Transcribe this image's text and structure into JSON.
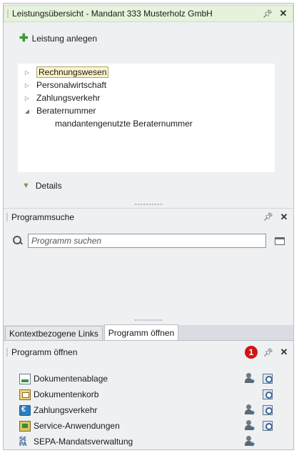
{
  "panel1": {
    "title": "Leistungsübersicht - Mandant 333 Musterholz GmbH",
    "add_label": "Leistung anlegen",
    "tree": [
      {
        "label": "Rechnungswesen",
        "expander": "▷"
      },
      {
        "label": "Personalwirtschaft",
        "expander": "▷"
      },
      {
        "label": "Zahlungsverkehr",
        "expander": "▷"
      },
      {
        "label": "Beraternummer",
        "expander": "◢"
      },
      {
        "label": "mandantengenutzte Beraternummer",
        "expander": ""
      }
    ],
    "details_label": "Details",
    "pin_icon": "pin-icon",
    "close_icon": "close-icon"
  },
  "panel2": {
    "title": "Programmsuche",
    "search_placeholder": "Programm suchen"
  },
  "tabs": [
    {
      "label": "Kontextbezogene Links",
      "active": false
    },
    {
      "label": "Programm öffnen",
      "active": true
    }
  ],
  "panel3": {
    "title": "Programm öffnen",
    "badge": "1",
    "programs": [
      {
        "label": "Dokumentenablage",
        "icon": "document-archive-icon",
        "person": true,
        "search": true
      },
      {
        "label": "Dokumentenkorb",
        "icon": "document-basket-icon",
        "person": false,
        "search": true
      },
      {
        "label": "Zahlungsverkehr",
        "icon": "payment-icon",
        "person": true,
        "search": true
      },
      {
        "label": "Service-Anwendungen",
        "icon": "service-apps-icon",
        "person": true,
        "search": true
      },
      {
        "label": "SEPA-Mandatsverwaltung",
        "icon": "sepa-icon",
        "person": true,
        "search": false
      }
    ]
  },
  "colors": {
    "header_green": "#e7f2dc",
    "selection": "#fbf3c9",
    "badge_red": "#d01515"
  }
}
